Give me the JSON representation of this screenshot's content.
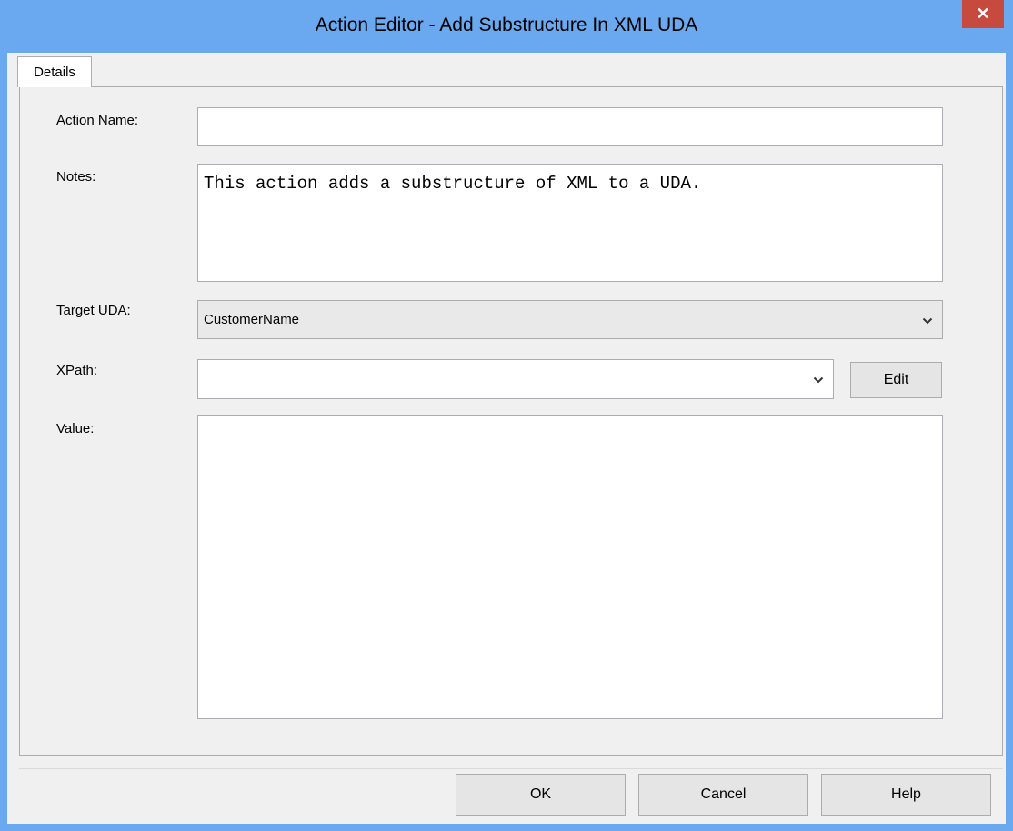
{
  "window": {
    "title": "Action Editor - Add Substructure In XML UDA",
    "close_glyph": "✕"
  },
  "tabs": [
    {
      "label": "Details",
      "selected": true
    }
  ],
  "form": {
    "action_name": {
      "label": "Action Name:",
      "value": ""
    },
    "notes": {
      "label": "Notes:",
      "value": "This action adds a substructure of XML to a UDA."
    },
    "target_uda": {
      "label": "Target UDA:",
      "value": "CustomerName"
    },
    "xpath": {
      "label": "XPath:",
      "value": "",
      "edit_label": "Edit"
    },
    "value": {
      "label": "Value:",
      "value": ""
    }
  },
  "buttons": {
    "ok": "OK",
    "cancel": "Cancel",
    "help": "Help"
  },
  "colors": {
    "frame": "#6aa9f0",
    "close": "#c74a3f",
    "panel": "#f0f0f0"
  },
  "icons": {
    "close": "close-icon",
    "dropdown": "chevron-down-icon"
  }
}
